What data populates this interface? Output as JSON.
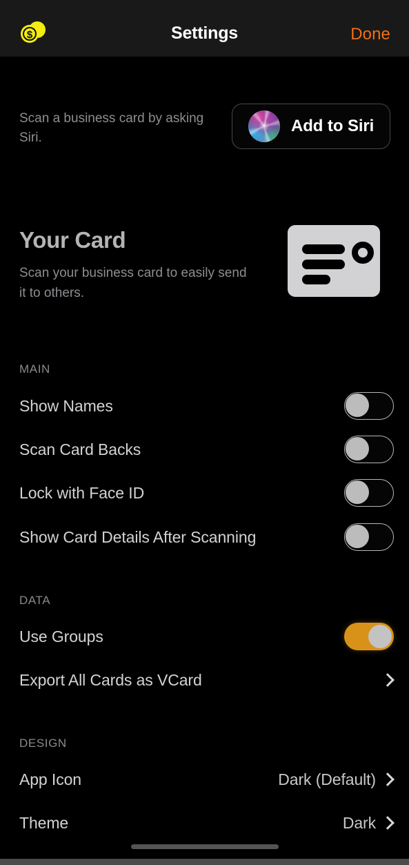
{
  "header": {
    "logo_icon": "coins-dollar-logo",
    "title": "Settings",
    "done_label": "Done",
    "accent_color": "#f26f15",
    "bg_color": "#191919"
  },
  "siri": {
    "description": "Scan a business card by asking Siri.",
    "button_label": "Add to Siri",
    "orb_icon": "siri-orb-icon"
  },
  "your_card": {
    "title": "Your Card",
    "description": "Scan your business card to easily send it to others.",
    "icon": "business-card-icon"
  },
  "sections": [
    {
      "header": "MAIN",
      "rows": [
        {
          "label": "Show Names",
          "control": "toggle",
          "value": "off"
        },
        {
          "label": "Scan Card Backs",
          "control": "toggle",
          "value": "off"
        },
        {
          "label": "Lock with Face ID",
          "control": "toggle",
          "value": "off"
        },
        {
          "label": "Show Card Details After Scanning",
          "control": "toggle",
          "value": "off"
        }
      ]
    },
    {
      "header": "DATA",
      "rows": [
        {
          "label": "Use Groups",
          "control": "toggle",
          "value": "on"
        },
        {
          "label": "Export All Cards as VCard",
          "control": "chevron",
          "value": ""
        }
      ]
    },
    {
      "header": "DESIGN",
      "rows": [
        {
          "label": "App Icon",
          "control": "chevron",
          "value": "Dark (Default)"
        },
        {
          "label": "Theme",
          "control": "chevron",
          "value": "Dark"
        }
      ]
    }
  ],
  "toggle_on_color": "#d8921a",
  "home_indicator": "home-indicator"
}
